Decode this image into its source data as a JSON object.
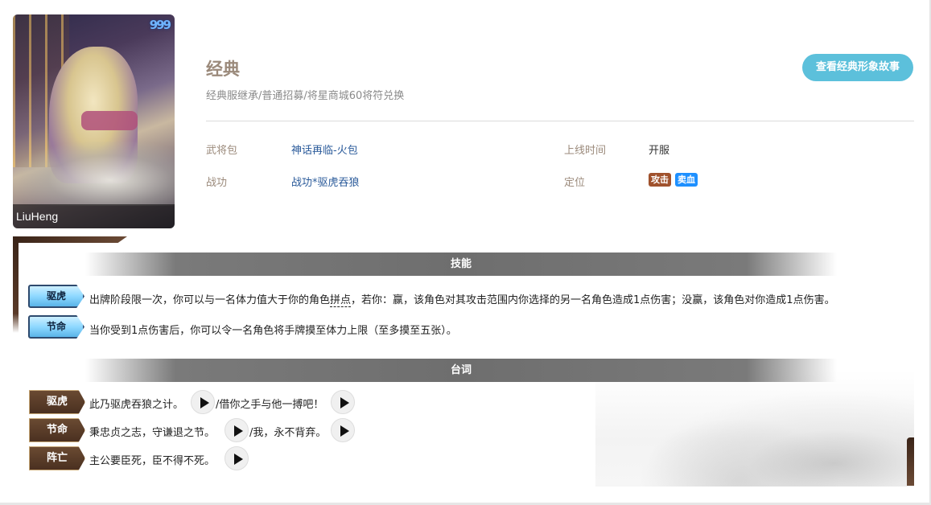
{
  "portrait": {
    "name": "LiuHeng",
    "gems": "999"
  },
  "skin": {
    "title": "经典",
    "subtitle": "经典服继承/普通招募/将星商城60将符兑换",
    "story_button": "查看经典形象故事"
  },
  "info": {
    "pack_label": "武将包",
    "pack_value": "神话再临-火包",
    "online_label": "上线时间",
    "online_value": "开服",
    "merit_label": "战功",
    "merit_value": "战功*驱虎吞狼",
    "role_label": "定位",
    "tags": [
      {
        "text": "攻击",
        "color": "#a0522d"
      },
      {
        "text": "卖血",
        "color": "#1e90ff"
      }
    ]
  },
  "skills": {
    "heading": "技能",
    "items": [
      {
        "name": "驱虎",
        "desc_pre": "出牌阶段限一次，你可以与一名体力值大于你的角色",
        "desc_term": "拼点",
        "desc_post": "，若你：赢，该角色对其攻击范围内你选择的另一名角色造成1点伤害；没赢，该角色对你造成1点伤害。"
      },
      {
        "name": "节命",
        "desc_pre": "当你受到1点伤害后，你可以令一名角色将手牌摸至体力上限（至多摸至五张）。"
      }
    ]
  },
  "lines": {
    "heading": "台词",
    "items": [
      {
        "name": "驱虎",
        "line1": "此乃驱虎吞狼之计。",
        "line2": "/借你之手与他一搏吧！"
      },
      {
        "name": "节命",
        "line1": "秉忠贞之志，守谦退之节。",
        "line2": "/我，永不背弃。"
      },
      {
        "name": "阵亡",
        "line1": "主公要臣死，臣不得不死。"
      }
    ]
  },
  "colors": {
    "accent": "#5cc0db",
    "label": "#9b8a7b",
    "link": "#2a5a9a"
  }
}
